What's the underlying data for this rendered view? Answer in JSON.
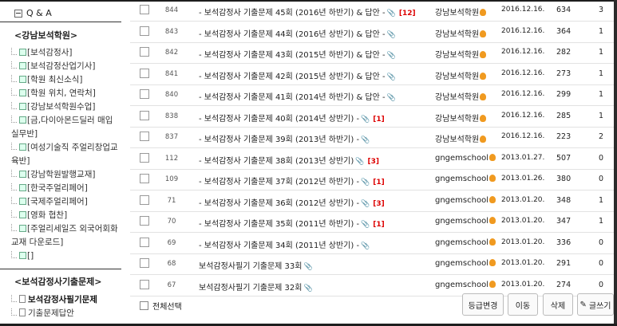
{
  "sidebar": {
    "qa_label": "Q & A",
    "section1_title": "<강남보석학원>",
    "section1_items": [
      "[보석감정사]",
      "[보석감정산업기사]",
      "[학원 최신소식]",
      "[학원 위치, 연락처]",
      "[강남보석학원수업]",
      "[금,다이아몬드딜러 매입",
      "실무반]",
      "[여성기술직 주얼리창업교",
      "육반]",
      "[강남학원발행교재]",
      "[한국주얼리페어]",
      "[국제주얼리페어]",
      "[영화 협찬]",
      "[주얼리세일즈 외국어회화",
      "교재 다운로드]",
      "[]"
    ],
    "section2_title": "<보석감정사기출문제>",
    "section2_items": [
      "보석감정사필기문제",
      "기출문제답안"
    ]
  },
  "posts": [
    {
      "num": "844",
      "title": "- 보석감정사 기출문제 45회 (2016년 하반기) & 답안 -",
      "comments": "[12]",
      "author": "강남보석학원",
      "date": "2016.12.16.",
      "views": "634",
      "votes": "3"
    },
    {
      "num": "843",
      "title": "- 보석감정사 기출문제 44회 (2016년 상반기) & 답안 -",
      "comments": "",
      "author": "강남보석학원",
      "date": "2016.12.16.",
      "views": "364",
      "votes": "1"
    },
    {
      "num": "842",
      "title": "- 보석감정사 기출문제 43회 (2015년 하반기) & 답안 -",
      "comments": "",
      "author": "강남보석학원",
      "date": "2016.12.16.",
      "views": "282",
      "votes": "1"
    },
    {
      "num": "841",
      "title": "- 보석감정사 기출문제 42회 (2015년 상반기) & 답안 -",
      "comments": "",
      "author": "강남보석학원",
      "date": "2016.12.16.",
      "views": "273",
      "votes": "1"
    },
    {
      "num": "840",
      "title": "- 보석감정사 기출문제 41회 (2014년 하반기) & 답안 -",
      "comments": "",
      "author": "강남보석학원",
      "date": "2016.12.16.",
      "views": "299",
      "votes": "1"
    },
    {
      "num": "838",
      "title": "- 보석감정사 기출문제 40회 (2014년 상반기) -",
      "comments": "[1]",
      "author": "강남보석학원",
      "date": "2016.12.16.",
      "views": "285",
      "votes": "1"
    },
    {
      "num": "837",
      "title": "- 보석감정사 기출문제 39회 (2013년 하반기) -",
      "comments": "",
      "author": "강남보석학원",
      "date": "2016.12.16.",
      "views": "223",
      "votes": "2"
    },
    {
      "num": "112",
      "title": "- 보석감정사 기출문제 38회 (2013년 상반기)",
      "comments": "[3]",
      "author": "gngemschool",
      "date": "2013.01.27.",
      "views": "507",
      "votes": "0"
    },
    {
      "num": "109",
      "title": "- 보석감정사 기출문제 37회 (2012년 하반기) -",
      "comments": "[1]",
      "author": "gngemschool",
      "date": "2013.01.26.",
      "views": "380",
      "votes": "0"
    },
    {
      "num": "71",
      "title": "- 보석감정사 기출문제 36회 (2012년 상반기) -",
      "comments": "[3]",
      "author": "gngemschool",
      "date": "2013.01.20.",
      "views": "348",
      "votes": "1"
    },
    {
      "num": "70",
      "title": "- 보석감정사 기출문제 35회 (2011년 하반기) -",
      "comments": "[1]",
      "author": "gngemschool",
      "date": "2013.01.20.",
      "views": "347",
      "votes": "1"
    },
    {
      "num": "69",
      "title": "- 보석감정사 기출문제 34회 (2011년 상반기) -",
      "comments": "",
      "author": "gngemschool",
      "date": "2013.01.20.",
      "views": "336",
      "votes": "0"
    },
    {
      "num": "68",
      "title": "보석감정사필기 기출문제 33회",
      "comments": "",
      "author": "gngemschool",
      "date": "2013.01.20.",
      "views": "291",
      "votes": "0"
    },
    {
      "num": "67",
      "title": "보석감정사필기 기출문제 32회",
      "comments": "",
      "author": "gngemschool",
      "date": "2013.01.20.",
      "views": "274",
      "votes": "0"
    }
  ],
  "bottom": {
    "select_all": "전체선택",
    "grade_change": "등급변경",
    "move": "이동",
    "delete": "삭제",
    "write": "글쓰기"
  },
  "colors": {
    "comment": "#dd0000",
    "flame": "#f09a20"
  }
}
